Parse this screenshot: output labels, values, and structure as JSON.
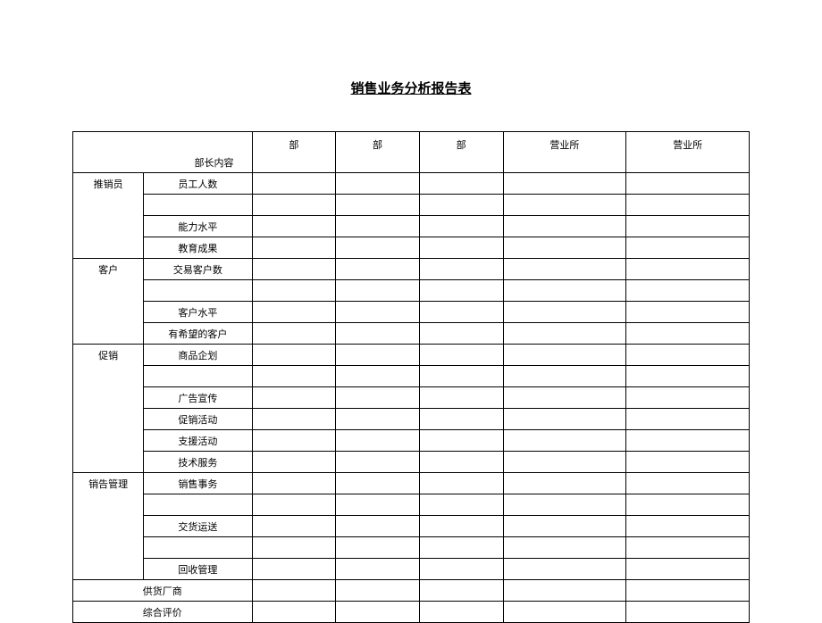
{
  "title": "销售业务分析报告表",
  "cornerLabel": "部长内容",
  "headers": {
    "dept1": "部",
    "dept2": "部",
    "dept3": "部",
    "office1": "营业所",
    "office2": "营业所"
  },
  "categories": {
    "salesperson": {
      "label": "推销员",
      "items": {
        "staff": "员工人数",
        "blank1": "",
        "ability": "能力水平",
        "education": "教育成果"
      }
    },
    "customer": {
      "label": "客户",
      "items": {
        "count": "交易客户数",
        "blank1": "",
        "level": "客户水平",
        "prospect": "有希望的客户"
      }
    },
    "promotion": {
      "label": "促销",
      "items": {
        "planning": "商品企划",
        "blank1": "",
        "advertising": "广告宣传",
        "activity": "促销活动",
        "support": "支援活动",
        "tech": "技术服务"
      }
    },
    "salesMgmt": {
      "label": "销告管理",
      "items": {
        "affairs": "销售事务",
        "blank1": "",
        "delivery": "交货运送",
        "blank2": "",
        "recovery": "回收管理"
      }
    }
  },
  "footerRows": {
    "supplier": "供货厂商",
    "evaluation": "综合评价"
  }
}
